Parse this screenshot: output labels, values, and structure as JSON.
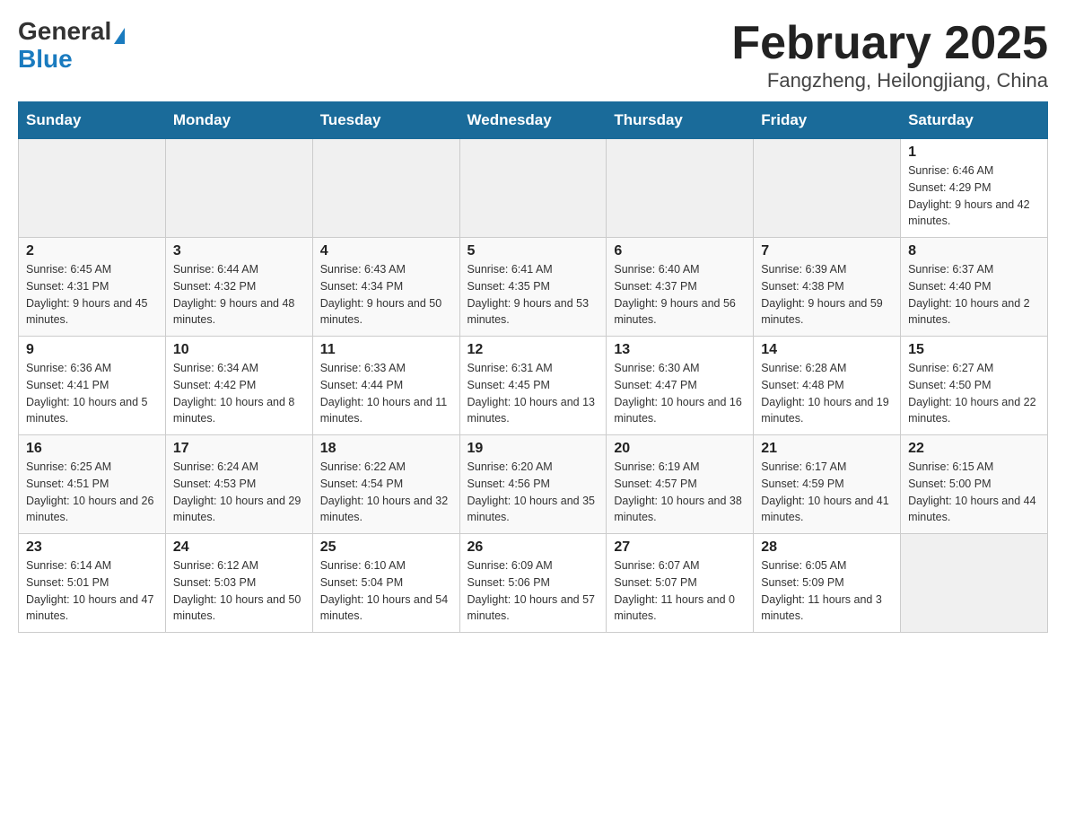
{
  "header": {
    "logo_general": "General",
    "logo_blue": "Blue",
    "month_title": "February 2025",
    "location": "Fangzheng, Heilongjiang, China"
  },
  "weekdays": [
    "Sunday",
    "Monday",
    "Tuesday",
    "Wednesday",
    "Thursday",
    "Friday",
    "Saturday"
  ],
  "weeks": [
    [
      {
        "day": "",
        "info": ""
      },
      {
        "day": "",
        "info": ""
      },
      {
        "day": "",
        "info": ""
      },
      {
        "day": "",
        "info": ""
      },
      {
        "day": "",
        "info": ""
      },
      {
        "day": "",
        "info": ""
      },
      {
        "day": "1",
        "info": "Sunrise: 6:46 AM\nSunset: 4:29 PM\nDaylight: 9 hours and 42 minutes."
      }
    ],
    [
      {
        "day": "2",
        "info": "Sunrise: 6:45 AM\nSunset: 4:31 PM\nDaylight: 9 hours and 45 minutes."
      },
      {
        "day": "3",
        "info": "Sunrise: 6:44 AM\nSunset: 4:32 PM\nDaylight: 9 hours and 48 minutes."
      },
      {
        "day": "4",
        "info": "Sunrise: 6:43 AM\nSunset: 4:34 PM\nDaylight: 9 hours and 50 minutes."
      },
      {
        "day": "5",
        "info": "Sunrise: 6:41 AM\nSunset: 4:35 PM\nDaylight: 9 hours and 53 minutes."
      },
      {
        "day": "6",
        "info": "Sunrise: 6:40 AM\nSunset: 4:37 PM\nDaylight: 9 hours and 56 minutes."
      },
      {
        "day": "7",
        "info": "Sunrise: 6:39 AM\nSunset: 4:38 PM\nDaylight: 9 hours and 59 minutes."
      },
      {
        "day": "8",
        "info": "Sunrise: 6:37 AM\nSunset: 4:40 PM\nDaylight: 10 hours and 2 minutes."
      }
    ],
    [
      {
        "day": "9",
        "info": "Sunrise: 6:36 AM\nSunset: 4:41 PM\nDaylight: 10 hours and 5 minutes."
      },
      {
        "day": "10",
        "info": "Sunrise: 6:34 AM\nSunset: 4:42 PM\nDaylight: 10 hours and 8 minutes."
      },
      {
        "day": "11",
        "info": "Sunrise: 6:33 AM\nSunset: 4:44 PM\nDaylight: 10 hours and 11 minutes."
      },
      {
        "day": "12",
        "info": "Sunrise: 6:31 AM\nSunset: 4:45 PM\nDaylight: 10 hours and 13 minutes."
      },
      {
        "day": "13",
        "info": "Sunrise: 6:30 AM\nSunset: 4:47 PM\nDaylight: 10 hours and 16 minutes."
      },
      {
        "day": "14",
        "info": "Sunrise: 6:28 AM\nSunset: 4:48 PM\nDaylight: 10 hours and 19 minutes."
      },
      {
        "day": "15",
        "info": "Sunrise: 6:27 AM\nSunset: 4:50 PM\nDaylight: 10 hours and 22 minutes."
      }
    ],
    [
      {
        "day": "16",
        "info": "Sunrise: 6:25 AM\nSunset: 4:51 PM\nDaylight: 10 hours and 26 minutes."
      },
      {
        "day": "17",
        "info": "Sunrise: 6:24 AM\nSunset: 4:53 PM\nDaylight: 10 hours and 29 minutes."
      },
      {
        "day": "18",
        "info": "Sunrise: 6:22 AM\nSunset: 4:54 PM\nDaylight: 10 hours and 32 minutes."
      },
      {
        "day": "19",
        "info": "Sunrise: 6:20 AM\nSunset: 4:56 PM\nDaylight: 10 hours and 35 minutes."
      },
      {
        "day": "20",
        "info": "Sunrise: 6:19 AM\nSunset: 4:57 PM\nDaylight: 10 hours and 38 minutes."
      },
      {
        "day": "21",
        "info": "Sunrise: 6:17 AM\nSunset: 4:59 PM\nDaylight: 10 hours and 41 minutes."
      },
      {
        "day": "22",
        "info": "Sunrise: 6:15 AM\nSunset: 5:00 PM\nDaylight: 10 hours and 44 minutes."
      }
    ],
    [
      {
        "day": "23",
        "info": "Sunrise: 6:14 AM\nSunset: 5:01 PM\nDaylight: 10 hours and 47 minutes."
      },
      {
        "day": "24",
        "info": "Sunrise: 6:12 AM\nSunset: 5:03 PM\nDaylight: 10 hours and 50 minutes."
      },
      {
        "day": "25",
        "info": "Sunrise: 6:10 AM\nSunset: 5:04 PM\nDaylight: 10 hours and 54 minutes."
      },
      {
        "day": "26",
        "info": "Sunrise: 6:09 AM\nSunset: 5:06 PM\nDaylight: 10 hours and 57 minutes."
      },
      {
        "day": "27",
        "info": "Sunrise: 6:07 AM\nSunset: 5:07 PM\nDaylight: 11 hours and 0 minutes."
      },
      {
        "day": "28",
        "info": "Sunrise: 6:05 AM\nSunset: 5:09 PM\nDaylight: 11 hours and 3 minutes."
      },
      {
        "day": "",
        "info": ""
      }
    ]
  ]
}
